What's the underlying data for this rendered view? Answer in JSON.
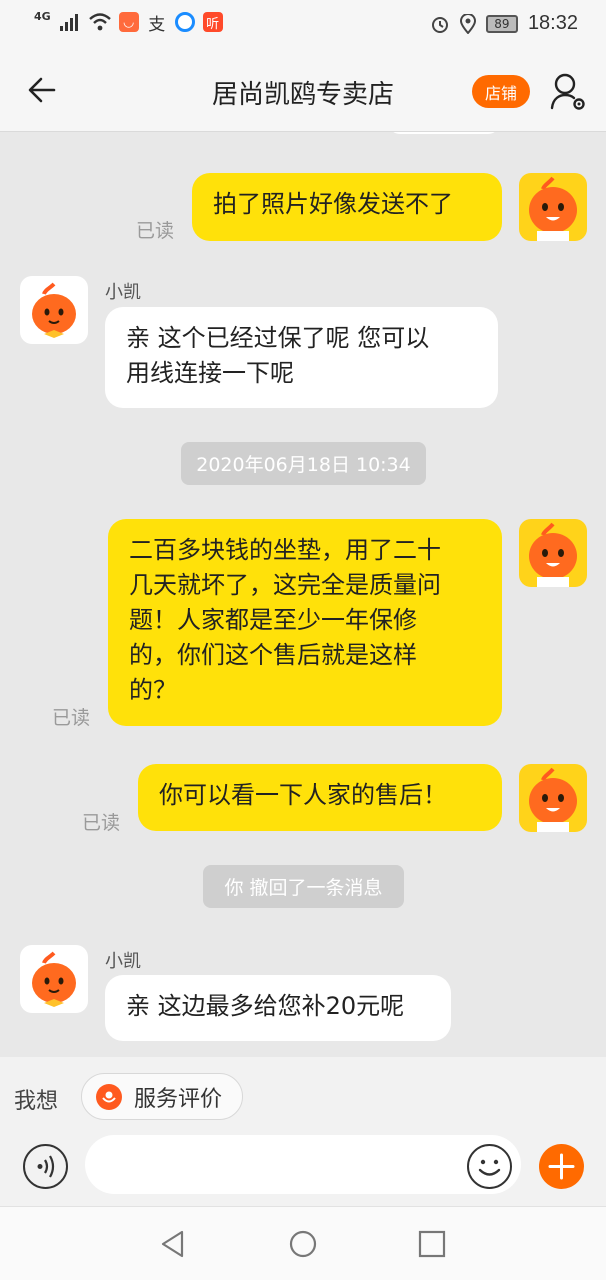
{
  "status_bar": {
    "network": "4G",
    "app_icons": [
      "xiaohongshu-icon",
      "zhifubao-icon",
      "browser-icon",
      "ting-icon"
    ],
    "battery": "89",
    "time": "18:32"
  },
  "header": {
    "title": "居尚凯鸥专卖店",
    "shop_label": "店铺"
  },
  "messages": [
    {
      "type": "out",
      "text": "拍了照片好像发送不了",
      "read": "已读"
    },
    {
      "type": "in",
      "sender": "小凯",
      "lines": [
        "亲 这个已经过保了呢  您可以",
        "用线连接一下呢"
      ]
    },
    {
      "type": "timestamp",
      "text": "2020年06月18日 10:34"
    },
    {
      "type": "out",
      "lines": [
        "二百多块钱的坐垫，用了二十",
        "几天就坏了，这完全是质量问",
        "题！人家都是至少一年保修",
        "的，你们这个售后就是这样",
        "的？"
      ],
      "read": "已读"
    },
    {
      "type": "out",
      "text": "你可以看一下人家的售后！",
      "read": "已读"
    },
    {
      "type": "system",
      "text": "你 撤回了一条消息"
    },
    {
      "type": "in",
      "sender": "小凯",
      "text": "亲 这边最多给您补20元呢"
    }
  ],
  "quick_bar": {
    "label": "我想",
    "chip_label": "服务评价"
  },
  "input_bar": {
    "value": "",
    "placeholder": ""
  },
  "colors": {
    "accent": "#ff6a00",
    "outgoing_bubble": "#ffe10a",
    "incoming_bubble": "#ffffff",
    "chat_background": "#e8e8e8"
  }
}
